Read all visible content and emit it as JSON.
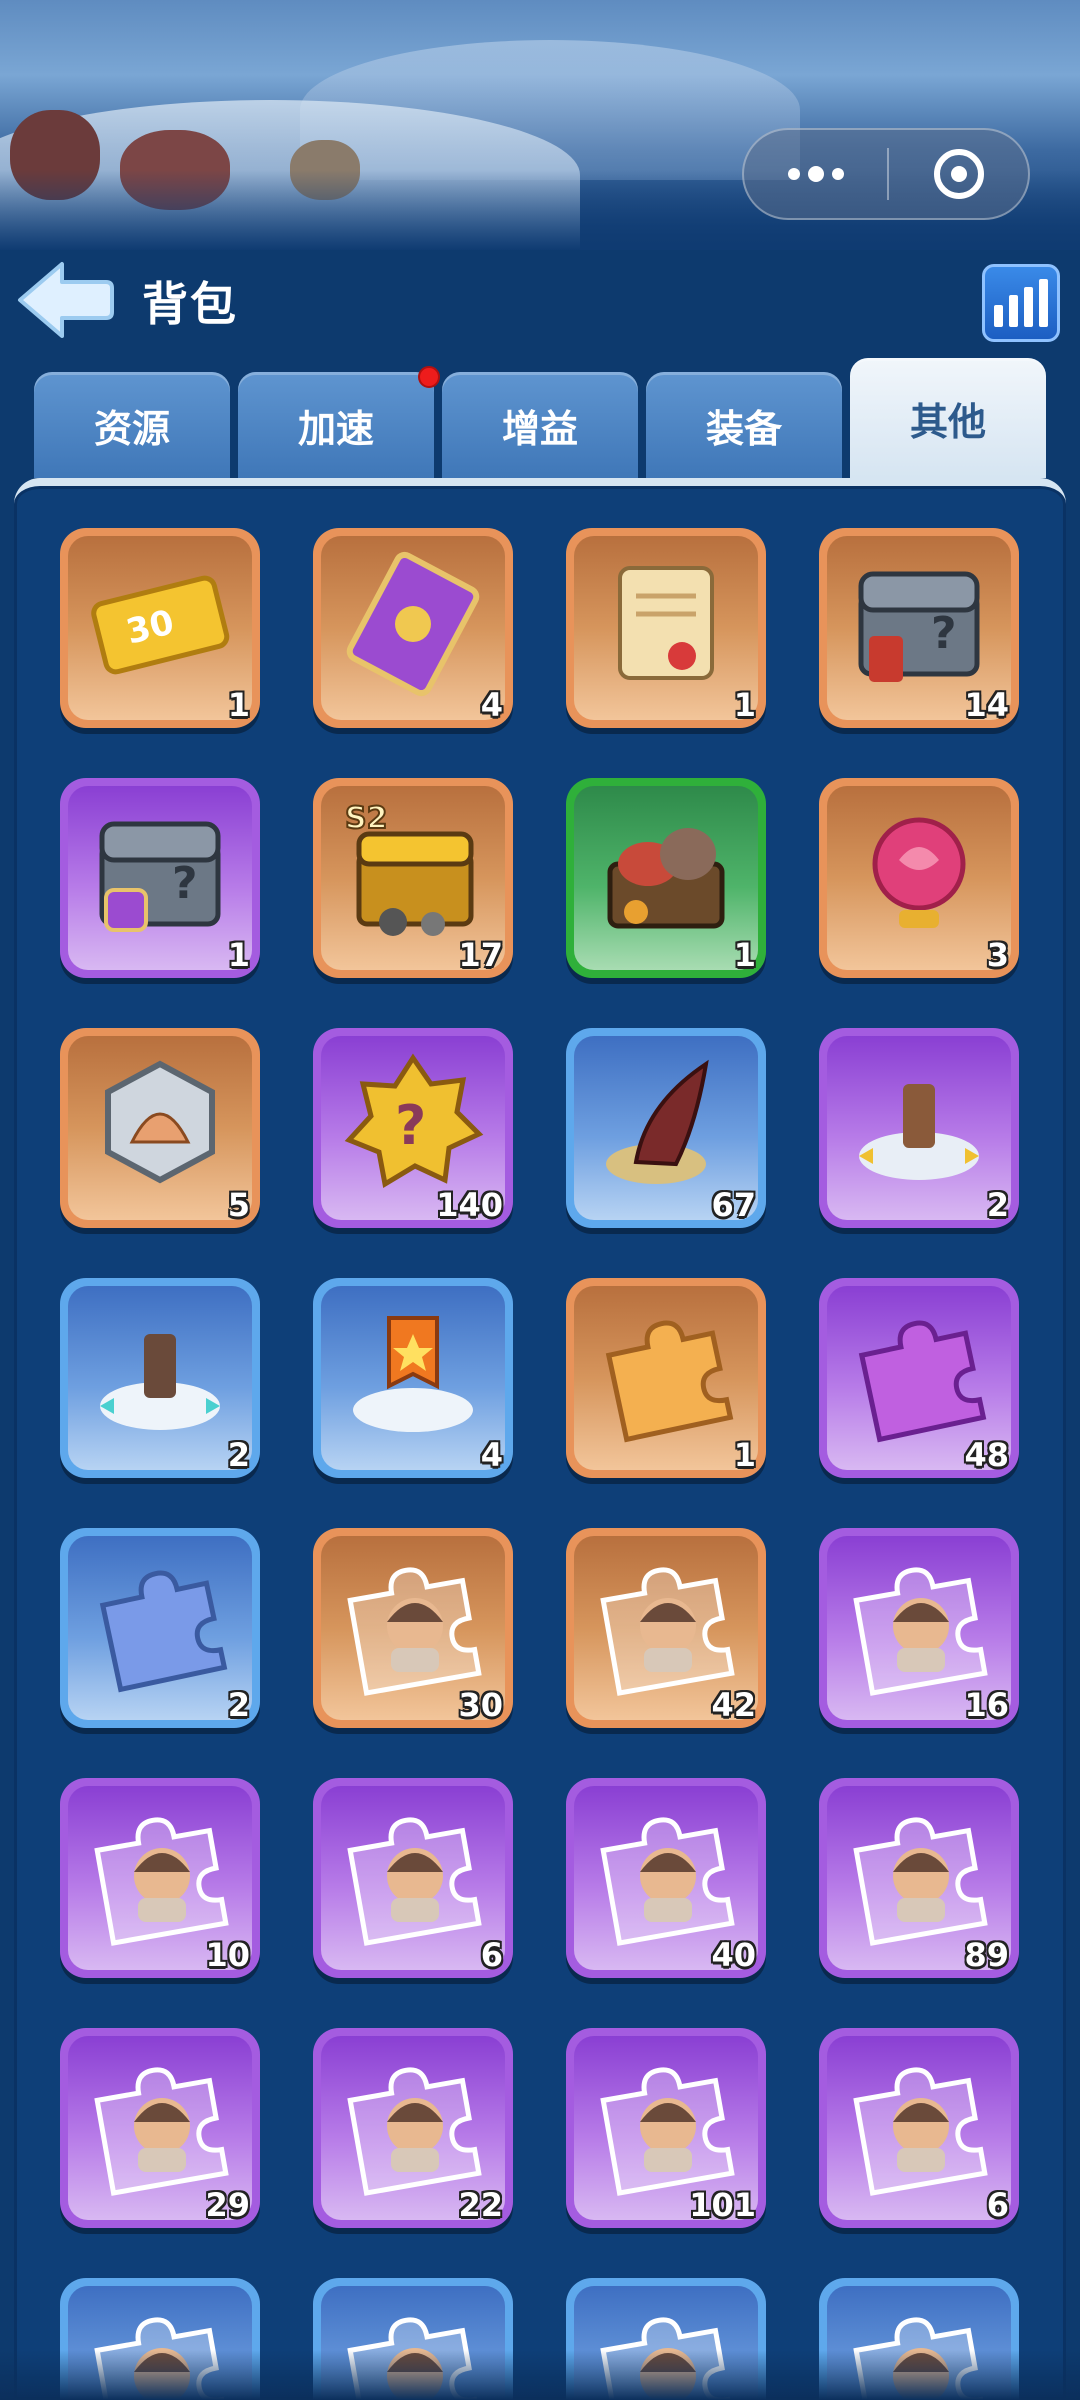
{
  "header": {
    "title": "背包"
  },
  "tabs": [
    {
      "label": "资源",
      "active": false,
      "badge": false
    },
    {
      "label": "加速",
      "active": false,
      "badge": true
    },
    {
      "label": "增益",
      "active": false,
      "badge": false
    },
    {
      "label": "装备",
      "active": false,
      "badge": false
    },
    {
      "label": "其他",
      "active": true,
      "badge": false
    }
  ],
  "items": [
    {
      "rarity": "orange",
      "icon": "ticket-30-icon",
      "count": "1"
    },
    {
      "rarity": "orange",
      "icon": "purple-card-icon",
      "count": "4"
    },
    {
      "rarity": "orange",
      "icon": "scroll-icon",
      "count": "1"
    },
    {
      "rarity": "orange",
      "icon": "mystery-chest-icon",
      "count": "14"
    },
    {
      "rarity": "purple",
      "icon": "mystery-chest-purple-icon",
      "count": "1"
    },
    {
      "rarity": "orange",
      "icon": "s2-treasure-chest-icon",
      "count": "17"
    },
    {
      "rarity": "green",
      "icon": "food-crate-icon",
      "count": "1"
    },
    {
      "rarity": "orange",
      "icon": "rose-icon",
      "count": "3"
    },
    {
      "rarity": "orange",
      "icon": "shell-token-icon",
      "count": "5"
    },
    {
      "rarity": "purple",
      "icon": "mystery-badge-icon",
      "count": "140"
    },
    {
      "rarity": "blue",
      "icon": "claw-icon",
      "count": "67"
    },
    {
      "rarity": "purple",
      "icon": "statue-relocate-icon",
      "count": "2"
    },
    {
      "rarity": "blue",
      "icon": "statue-relocate-blue-icon",
      "count": "2"
    },
    {
      "rarity": "blue",
      "icon": "banner-relocate-icon",
      "count": "4"
    },
    {
      "rarity": "orange",
      "icon": "puzzle-orange-icon",
      "count": "1"
    },
    {
      "rarity": "purple",
      "icon": "puzzle-purple-icon",
      "count": "48"
    },
    {
      "rarity": "blue",
      "icon": "puzzle-blue-icon",
      "count": "2"
    },
    {
      "rarity": "orange",
      "icon": "hero-puzzle-icon",
      "count": "30"
    },
    {
      "rarity": "orange",
      "icon": "hero-puzzle-icon",
      "count": "42"
    },
    {
      "rarity": "purple",
      "icon": "hero-puzzle-icon",
      "count": "16"
    },
    {
      "rarity": "purple",
      "icon": "hero-puzzle-icon",
      "count": "10"
    },
    {
      "rarity": "purple",
      "icon": "hero-puzzle-icon",
      "count": "6"
    },
    {
      "rarity": "purple",
      "icon": "hero-puzzle-icon",
      "count": "40"
    },
    {
      "rarity": "purple",
      "icon": "hero-puzzle-icon",
      "count": "89"
    },
    {
      "rarity": "purple",
      "icon": "hero-puzzle-icon",
      "count": "29"
    },
    {
      "rarity": "purple",
      "icon": "hero-puzzle-icon",
      "count": "22"
    },
    {
      "rarity": "purple",
      "icon": "hero-puzzle-icon",
      "count": "101"
    },
    {
      "rarity": "purple",
      "icon": "hero-puzzle-icon",
      "count": "6"
    },
    {
      "rarity": "blue",
      "icon": "hero-puzzle-icon",
      "count": ""
    },
    {
      "rarity": "blue",
      "icon": "hero-puzzle-icon",
      "count": ""
    },
    {
      "rarity": "blue",
      "icon": "hero-puzzle-icon",
      "count": ""
    },
    {
      "rarity": "blue",
      "icon": "hero-puzzle-icon",
      "count": ""
    }
  ]
}
